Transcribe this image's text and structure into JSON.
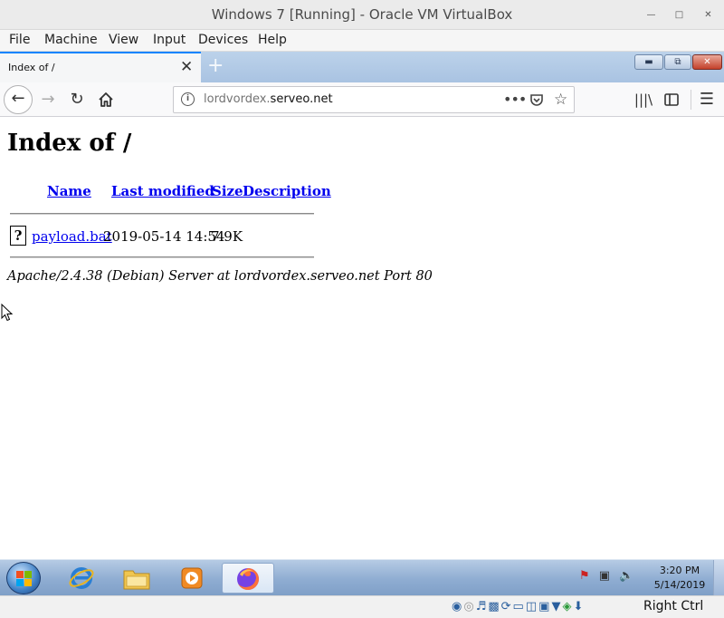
{
  "vbox": {
    "title": "Windows 7 [Running] - Oracle VM VirtualBox",
    "menu": [
      "File",
      "Machine",
      "View",
      "Input",
      "Devices",
      "Help"
    ],
    "host_key": "Right Ctrl"
  },
  "firefox": {
    "tab_title": "Index of /",
    "url_prefix": "lordvordex.",
    "url_domain": "serveo.net"
  },
  "page": {
    "heading": "Index of /",
    "columns": [
      "Name",
      "Last modified",
      "Size",
      "Description"
    ],
    "files": [
      {
        "name": "payload.bat",
        "modified": "2019-05-14 14:54",
        "size": "7.9K",
        "description": ""
      }
    ],
    "address": "Apache/2.4.38 (Debian) Server at lordvordex.serveo.net Port 80"
  },
  "taskbar": {
    "apps": [
      "internet-explorer",
      "windows-explorer",
      "windows-media-player",
      "firefox"
    ],
    "time": "3:20 PM",
    "date": "5/14/2019"
  },
  "colors": {
    "link": "#0000ee",
    "taskbar": "#8fadd2",
    "firefox_accent": "#0a84ff"
  }
}
